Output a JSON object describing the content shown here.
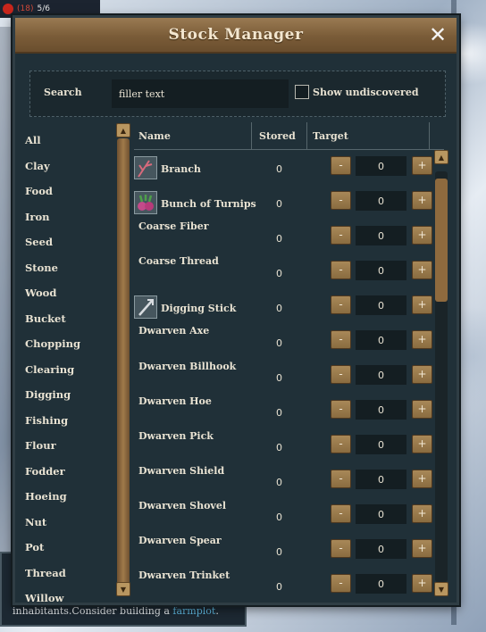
{
  "hud": {
    "text": "(18)",
    "text2": "5/6"
  },
  "message": {
    "text": "inhabitants.Consider building a ",
    "link": "farmplot",
    "end": "."
  },
  "window": {
    "title": "Stock Manager",
    "close_label": "✕"
  },
  "search": {
    "label": "Search",
    "value": "filler text",
    "show_undiscovered_label": "Show undiscovered"
  },
  "categories": [
    "All",
    "Clay",
    "Food",
    "Iron",
    "Seed",
    "Stone",
    "Wood",
    "Bucket",
    "Chopping",
    "Clearing",
    "Digging",
    "Fishing",
    "Flour",
    "Fodder",
    "Hoeing",
    "Nut",
    "Pot",
    "Thread",
    "Willow"
  ],
  "table": {
    "headers": {
      "name": "Name",
      "stored": "Stored",
      "target": "Target"
    },
    "minus_label": "-",
    "plus_label": "+",
    "rows": [
      {
        "name": "Branch",
        "stored": "0",
        "target": "0",
        "icon": "branch-icon"
      },
      {
        "name": "Bunch of Turnips",
        "stored": "0",
        "target": "0",
        "icon": "turnips-icon"
      },
      {
        "name": "Coarse Fiber",
        "stored": "0",
        "target": "0"
      },
      {
        "name": "Coarse Thread",
        "stored": "0",
        "target": "0"
      },
      {
        "name": "Digging Stick",
        "stored": "0",
        "target": "0",
        "icon": "digging-stick-icon"
      },
      {
        "name": "Dwarven Axe",
        "stored": "0",
        "target": "0"
      },
      {
        "name": "Dwarven Billhook",
        "stored": "0",
        "target": "0"
      },
      {
        "name": "Dwarven Hoe",
        "stored": "0",
        "target": "0"
      },
      {
        "name": "Dwarven Pick",
        "stored": "0",
        "target": "0"
      },
      {
        "name": "Dwarven Shield",
        "stored": "0",
        "target": "0"
      },
      {
        "name": "Dwarven Shovel",
        "stored": "0",
        "target": "0"
      },
      {
        "name": "Dwarven Spear",
        "stored": "0",
        "target": "0"
      },
      {
        "name": "Dwarven Trinket",
        "stored": "0",
        "target": "0"
      }
    ]
  },
  "colors": {
    "title_bar": "#7a5c38",
    "panel": "#203038",
    "accent_link": "#5fb8e0"
  }
}
